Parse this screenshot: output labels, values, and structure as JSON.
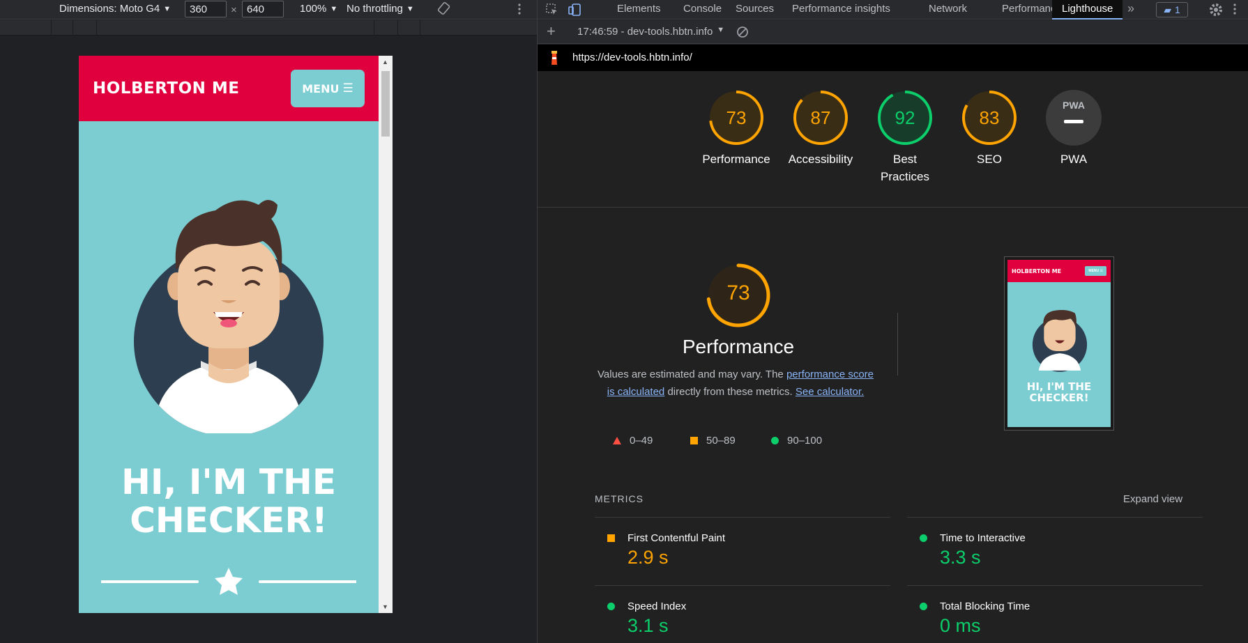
{
  "device_toolbar": {
    "dimensions_label": "Dimensions: Moto G4",
    "width": "360",
    "x_sep": "×",
    "height": "640",
    "zoom": "100%",
    "throttling": "No throttling"
  },
  "site": {
    "logo": "HOLBERTON ME",
    "menu_label": "MENU",
    "hero_line1": "HI, I'M THE",
    "hero_line2": "CHECKER!"
  },
  "devtools": {
    "tabs": [
      "Elements",
      "Console",
      "Sources",
      "Performance insights",
      "Network",
      "Performance",
      "Lighthouse"
    ],
    "active_tab": "Lighthouse",
    "issues_count": "1",
    "report_label": "17:46:59 - dev-tools.hbtn.info",
    "url": "https://dev-tools.hbtn.info/"
  },
  "scores": [
    {
      "value": "73",
      "label": "Performance",
      "color": "#ffa400"
    },
    {
      "value": "87",
      "label": "Accessibility",
      "color": "#ffa400"
    },
    {
      "value": "92",
      "label": "Best Practices",
      "color": "#0cce6b"
    },
    {
      "value": "83",
      "label": "SEO",
      "color": "#ffa400"
    },
    {
      "value": "PWA",
      "label": "PWA",
      "color": "#aaaaaa"
    }
  ],
  "perf": {
    "score": "73",
    "title": "Performance",
    "desc_prefix": "Values are estimated and may vary. The",
    "desc_link1": "performance score is calculated",
    "desc_mid": "directly from these metrics.",
    "desc_link2": "See calculator.",
    "legend": [
      {
        "range": "0–49",
        "color": "#ff4e42"
      },
      {
        "range": "50–89",
        "color": "#ffa400"
      },
      {
        "range": "90–100",
        "color": "#0cce6b"
      }
    ],
    "thumb_logo": "HOLBERTON ME",
    "thumb_menu": "MENU ☰",
    "thumb_hero1": "HI, I'M THE",
    "thumb_hero2": "CHECKER!"
  },
  "metrics": {
    "heading": "METRICS",
    "expand": "Expand view",
    "items": [
      {
        "label": "First Contentful Paint",
        "value": "2.9 s",
        "color": "#ffa400"
      },
      {
        "label": "Time to Interactive",
        "value": "3.3 s",
        "color": "#0cce6b"
      },
      {
        "label": "Speed Index",
        "value": "3.1 s",
        "color": "#0cce6b"
      },
      {
        "label": "Total Blocking Time",
        "value": "0 ms",
        "color": "#0cce6b"
      }
    ]
  }
}
